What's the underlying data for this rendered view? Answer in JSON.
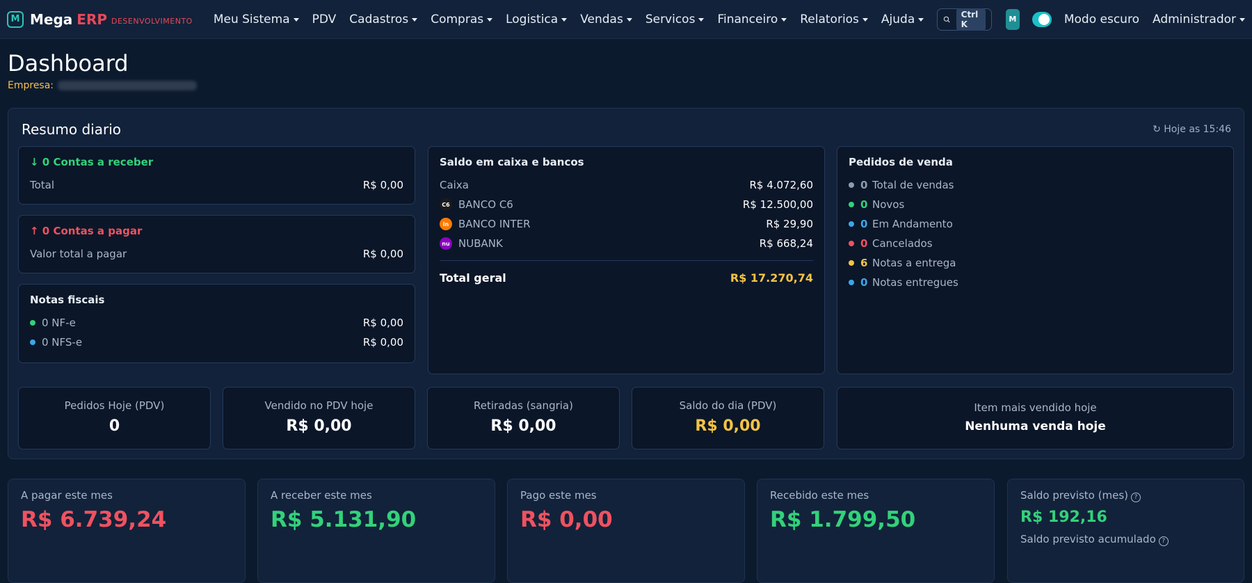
{
  "brand": {
    "logo": "M",
    "name": "Mega",
    "erp": "ERP",
    "env": "DESENVOLVIMENTO"
  },
  "nav": [
    {
      "label": "Meu Sistema",
      "dropdown": true
    },
    {
      "label": "PDV",
      "dropdown": false
    },
    {
      "label": "Cadastros",
      "dropdown": true
    },
    {
      "label": "Compras",
      "dropdown": true
    },
    {
      "label": "Logistica",
      "dropdown": true
    },
    {
      "label": "Vendas",
      "dropdown": true
    },
    {
      "label": "Servicos",
      "dropdown": true
    },
    {
      "label": "Financeiro",
      "dropdown": true
    },
    {
      "label": "Relatorios",
      "dropdown": true
    },
    {
      "label": "Ajuda",
      "dropdown": true
    }
  ],
  "search": {
    "shortcut": "Ctrl K"
  },
  "user": {
    "avatar": "M",
    "dark_mode_label": "Modo escuro",
    "dark_mode_on": true,
    "name": "Administrador"
  },
  "page": {
    "title": "Dashboard",
    "company_label": "Empresa:"
  },
  "resumo": {
    "title": "Resumo diario",
    "updated": "↻ Hoje as 15:46",
    "receber": {
      "title": "↓ 0 Contas a receber",
      "label": "Total",
      "value": "R$ 0,00"
    },
    "pagar": {
      "title": "↑ 0 Contas a pagar",
      "label": "Valor total a pagar",
      "value": "R$ 0,00"
    },
    "notas": {
      "title": "Notas fiscais",
      "items": [
        {
          "label": "0 NF-e",
          "value": "R$ 0,00",
          "color": "#33d17a"
        },
        {
          "label": "0 NFS-e",
          "value": "R$ 0,00",
          "color": "#3aa7e8"
        }
      ]
    },
    "saldo": {
      "title": "Saldo em caixa e bancos",
      "caixa_label": "Caixa",
      "caixa_value": "R$ 4.072,60",
      "banks": [
        {
          "label": "BANCO C6",
          "value": "R$ 12.500,00",
          "icon": "C6",
          "color": "#1b1b1b"
        },
        {
          "label": "BANCO INTER",
          "value": "R$ 29,90",
          "icon": "in",
          "color": "#ff7a00"
        },
        {
          "label": "NUBANK",
          "value": "R$ 668,24",
          "icon": "nu",
          "color": "#8a05be"
        }
      ],
      "total_label": "Total geral",
      "total_value": "R$ 17.270,74"
    },
    "pedidos": {
      "title": "Pedidos de venda",
      "items": [
        {
          "count": "0",
          "label": "Total de vendas",
          "color": "#8a9bb2"
        },
        {
          "count": "0",
          "label": "Novos",
          "color": "#33d17a"
        },
        {
          "count": "0",
          "label": "Em Andamento",
          "color": "#3aa7e8"
        },
        {
          "count": "0",
          "label": "Cancelados",
          "color": "#ef5260"
        },
        {
          "count": "6",
          "label": "Notas a entrega",
          "color": "#f6c344"
        },
        {
          "count": "0",
          "label": "Notas entregues",
          "color": "#3aa7e8"
        }
      ]
    },
    "stats": [
      {
        "label": "Pedidos Hoje (PDV)",
        "value": "0",
        "highlight": false
      },
      {
        "label": "Vendido no PDV hoje",
        "value": "R$ 0,00",
        "highlight": false
      },
      {
        "label": "Retiradas (sangria)",
        "value": "R$ 0,00",
        "highlight": false
      },
      {
        "label": "Saldo do dia (PDV)",
        "value": "R$ 0,00",
        "highlight": true
      }
    ],
    "top_item": {
      "label": "Item mais vendido hoje",
      "value": "Nenhuma venda hoje"
    }
  },
  "monthly": [
    {
      "label": "A pagar este mes",
      "value": "R$ 6.739,24",
      "color": "#ef5260"
    },
    {
      "label": "A receber este mes",
      "value": "R$ 5.131,90",
      "color": "#33d17a"
    },
    {
      "label": "Pago este mes",
      "value": "R$ 0,00",
      "color": "#ef5260"
    },
    {
      "label": "Recebido este mes",
      "value": "R$ 1.799,50",
      "color": "#33d17a"
    }
  ],
  "saldo_previsto": {
    "label": "Saldo previsto (mes)",
    "value": "R$ 192,16",
    "acumulado_label": "Saldo previsto acumulado"
  }
}
